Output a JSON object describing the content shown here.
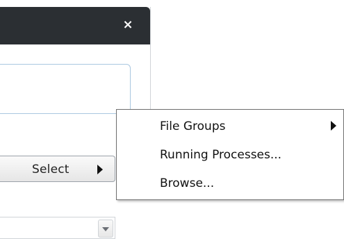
{
  "dialog": {
    "close_symbol": "×"
  },
  "select_button": {
    "label": "Select"
  },
  "submenu": {
    "items": [
      {
        "label": "File Groups",
        "has_submenu": true
      },
      {
        "label": "Running Processes...",
        "has_submenu": false
      },
      {
        "label": "Browse...",
        "has_submenu": false
      }
    ]
  }
}
